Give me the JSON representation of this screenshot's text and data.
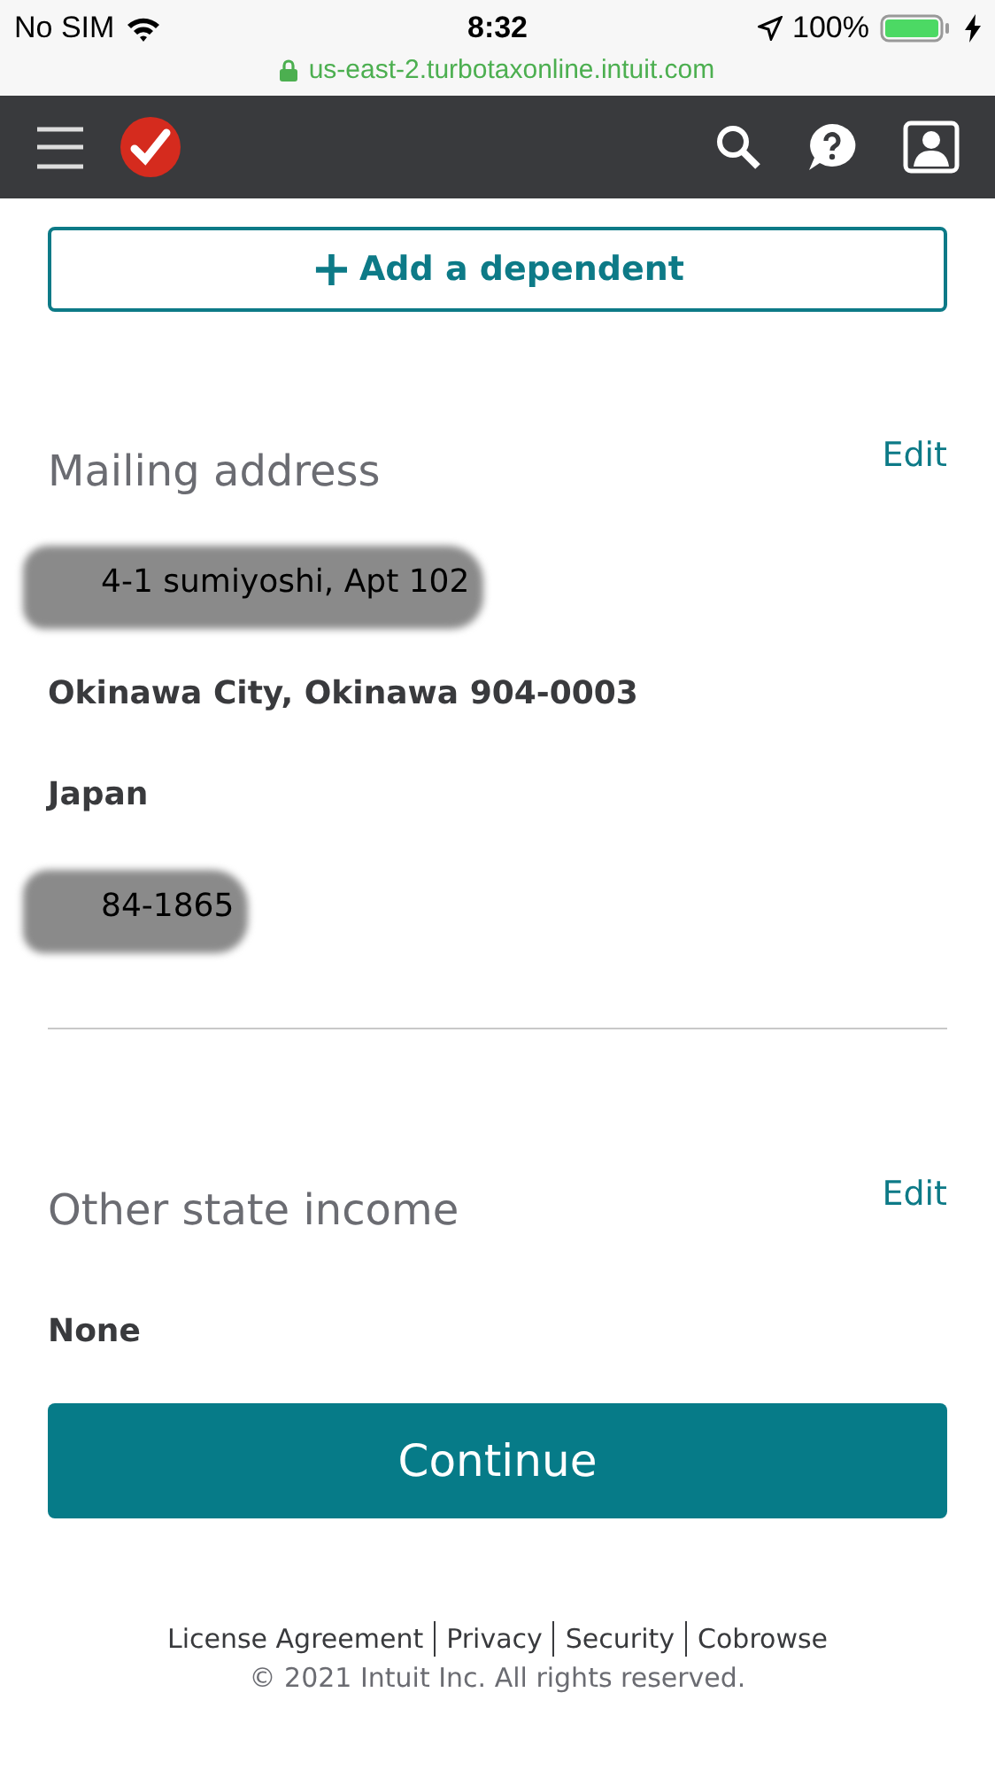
{
  "status_bar": {
    "carrier": "No SIM",
    "time": "8:32",
    "battery": "100%",
    "url": "us-east-2.turbotaxonline.intuit.com"
  },
  "add_dependent": {
    "icon": "+",
    "label": "Add a dependent"
  },
  "sections": [
    {
      "title": "Mailing address",
      "action": "Edit",
      "divider": true,
      "lines": [
        {
          "text": "4-1 sumiyoshi, Apt 102",
          "redacted": true
        },
        {
          "text": "Okinawa City, Okinawa 904-0003",
          "redacted": false
        },
        {
          "text": "Japan",
          "redacted": false
        },
        {
          "text": "84-1865",
          "redacted": true
        }
      ]
    },
    {
      "title": "Other state income",
      "action": "Edit",
      "divider": false,
      "lines": [
        {
          "text": "None",
          "redacted": false
        }
      ]
    }
  ],
  "continue_button": "Continue",
  "footer": {
    "links": [
      "License Agreement",
      "Privacy",
      "Security",
      "Cobrowse"
    ],
    "copyright": "© 2021 Intuit Inc. All rights reserved."
  }
}
